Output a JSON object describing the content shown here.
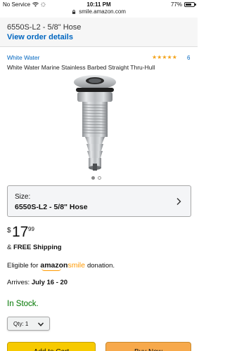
{
  "status_bar": {
    "carrier": "No Service",
    "time": "10:11 PM",
    "battery_text": "77%",
    "battery_level": 0.77
  },
  "browser": {
    "url": "smile.amazon.com"
  },
  "order": {
    "title": "6550S-L2 - 5/8\" Hose",
    "view_link": "View order details"
  },
  "product": {
    "brand": "White Water",
    "rating_count": "6",
    "star_count": 5,
    "title": "White Water Marine Stainless Barbed Straight Thru-Hull",
    "image_icon": "thru-hull-fitting-image"
  },
  "size_selector": {
    "label": "Size:",
    "value": "6550S-L2 - 5/8\" Hose"
  },
  "price": {
    "symbol": "$",
    "whole": "17",
    "fraction": "99"
  },
  "shipping": {
    "prefix": "& ",
    "text": "FREE Shipping"
  },
  "eligible": {
    "prefix": "Eligible for",
    "brand_a": "amazon",
    "brand_b": "smile",
    "suffix": "donation."
  },
  "delivery": {
    "label": "Arrives:",
    "dates": "July 16 - 20"
  },
  "stock": {
    "text": "In Stock."
  },
  "quantity": {
    "label": "Qty: 1"
  },
  "buttons": {
    "add_to_cart": "Add to Cart",
    "buy_now": "Buy Now"
  },
  "carousel": {
    "total": 2,
    "active": 1
  },
  "colors": {
    "link": "#0066c0",
    "stock_green": "#007600",
    "star": "#f4a41d",
    "cart_button": "#f7ca00",
    "buy_button": "#f7a94b"
  }
}
